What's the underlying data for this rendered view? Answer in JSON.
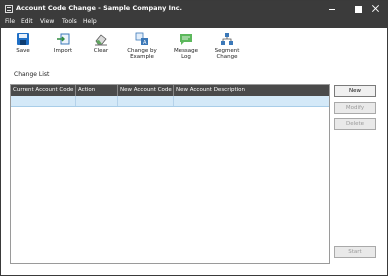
{
  "window": {
    "title": "Account Code Change - Sample Company Inc."
  },
  "menu": [
    "File",
    "Edit",
    "View",
    "Tools",
    "Help"
  ],
  "toolbar": {
    "save": "Save",
    "import": "Import",
    "clear": "Clear",
    "change_by_example_1": "Change by",
    "change_by_example_2": "Example",
    "message_log_1": "Message",
    "message_log_2": "Log",
    "segment_change_1": "Segment",
    "segment_change_2": "Change"
  },
  "list_label": "Change List",
  "grid": {
    "columns": [
      "Current Account Code",
      "Action",
      "New Account Code",
      "New Account Description"
    ]
  },
  "buttons": {
    "new": "New",
    "modify": "Modify",
    "delete": "Delete",
    "start": "Start"
  },
  "colors": {
    "titlebar": "#3b3b3b",
    "selected_row": "#d4e9f8"
  }
}
